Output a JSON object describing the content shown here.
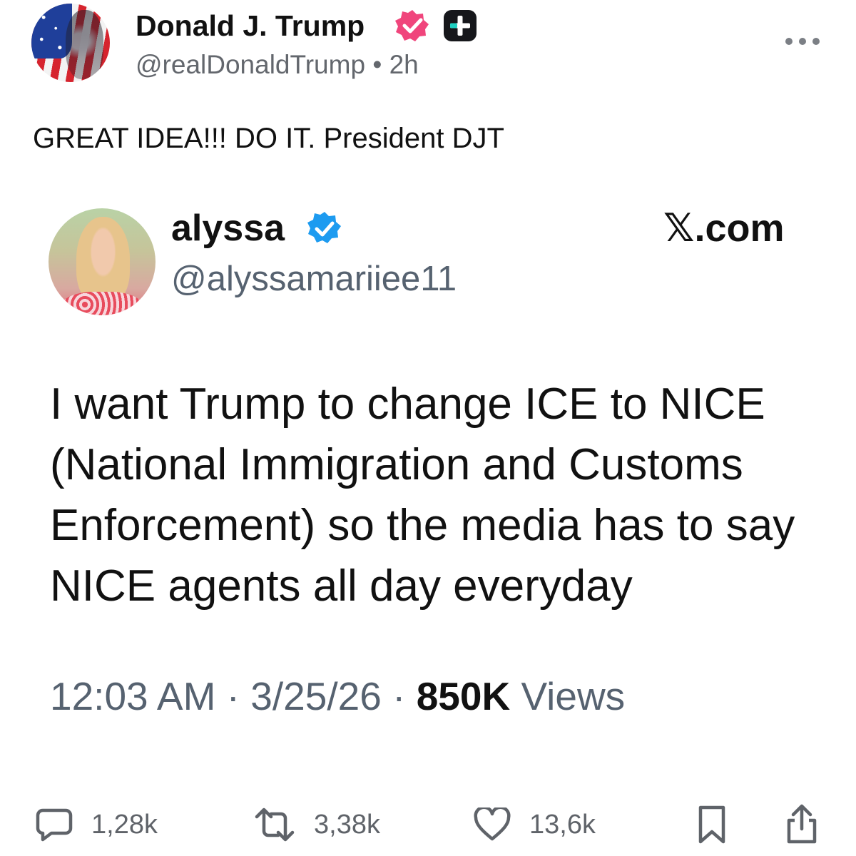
{
  "post": {
    "author_name": "Donald J. Trump",
    "handle": "@realDonaldTrump",
    "separator": "•",
    "time": "2h",
    "text": "GREAT IDEA!!! DO IT. President DJT",
    "more_icon": "more-horizontal-icon"
  },
  "quote": {
    "name": "alyssa",
    "handle": "@alyssamariiee11",
    "brand_glyph": "𝕏",
    "brand_suffix": ".com",
    "text_lines": [
      "I want Trump to change ICE to NICE",
      "(National Immigration and Customs",
      "Enforcement) so the media has to say",
      "NICE agents all day everyday"
    ],
    "time": "12:03 AM",
    "date": "3/25/26",
    "dot": "·",
    "views_count": "850K",
    "views_label": "Views"
  },
  "actions": {
    "replies": "1,28k",
    "reposts": "3,38k",
    "likes": "13,6k"
  },
  "colors": {
    "verified_badge": "#f0457c",
    "quote_verified": "#1d9bf0",
    "muted_text": "#63676d",
    "icon_gray": "#5f6369"
  }
}
